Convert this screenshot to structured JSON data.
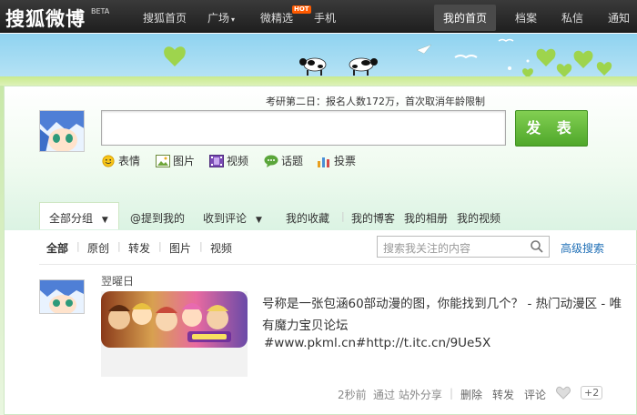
{
  "topbar": {
    "logo": "搜狐微博",
    "beta": "BETA",
    "nav": [
      "搜狐首页",
      "广场",
      "微精选",
      "手机"
    ],
    "hot_badge": "HOT",
    "right_nav": [
      "我的首页",
      "档案",
      "私信",
      "通知"
    ]
  },
  "composer": {
    "announcement": "考研第二日：报名人数172万，首次取消年龄限制",
    "publish_label": "发 表",
    "tools": [
      "表情",
      "图片",
      "视频",
      "话题",
      "投票"
    ]
  },
  "tabs": {
    "all_groups": "全部分组",
    "items": [
      "@提到我的",
      "收到评论",
      "我的收藏",
      "我的博客",
      "我的相册",
      "我的视频"
    ]
  },
  "filters": {
    "items": [
      "全部",
      "原创",
      "转发",
      "图片",
      "视频"
    ],
    "search_placeholder": "搜索我关注的内容",
    "advanced_search": "高级搜索"
  },
  "feed": {
    "author": "翌曜日",
    "text": "号称是一张包涵60部动漫的图，你能找到几个？ - 热门动漫区 - 唯有魔力宝贝论坛",
    "hash_link": "#www.pkml.cn#http://t.itc.cn/9Ue5X",
    "meta": {
      "time": "2秒前",
      "via": "通过 站外分享",
      "delete": "删除",
      "forward": "转发",
      "comment": "评论",
      "plus": "+2"
    }
  },
  "colors": {
    "topbar": "#2b2b2b",
    "publish_green": "#5cb434",
    "link_blue": "#1f6fb6"
  }
}
